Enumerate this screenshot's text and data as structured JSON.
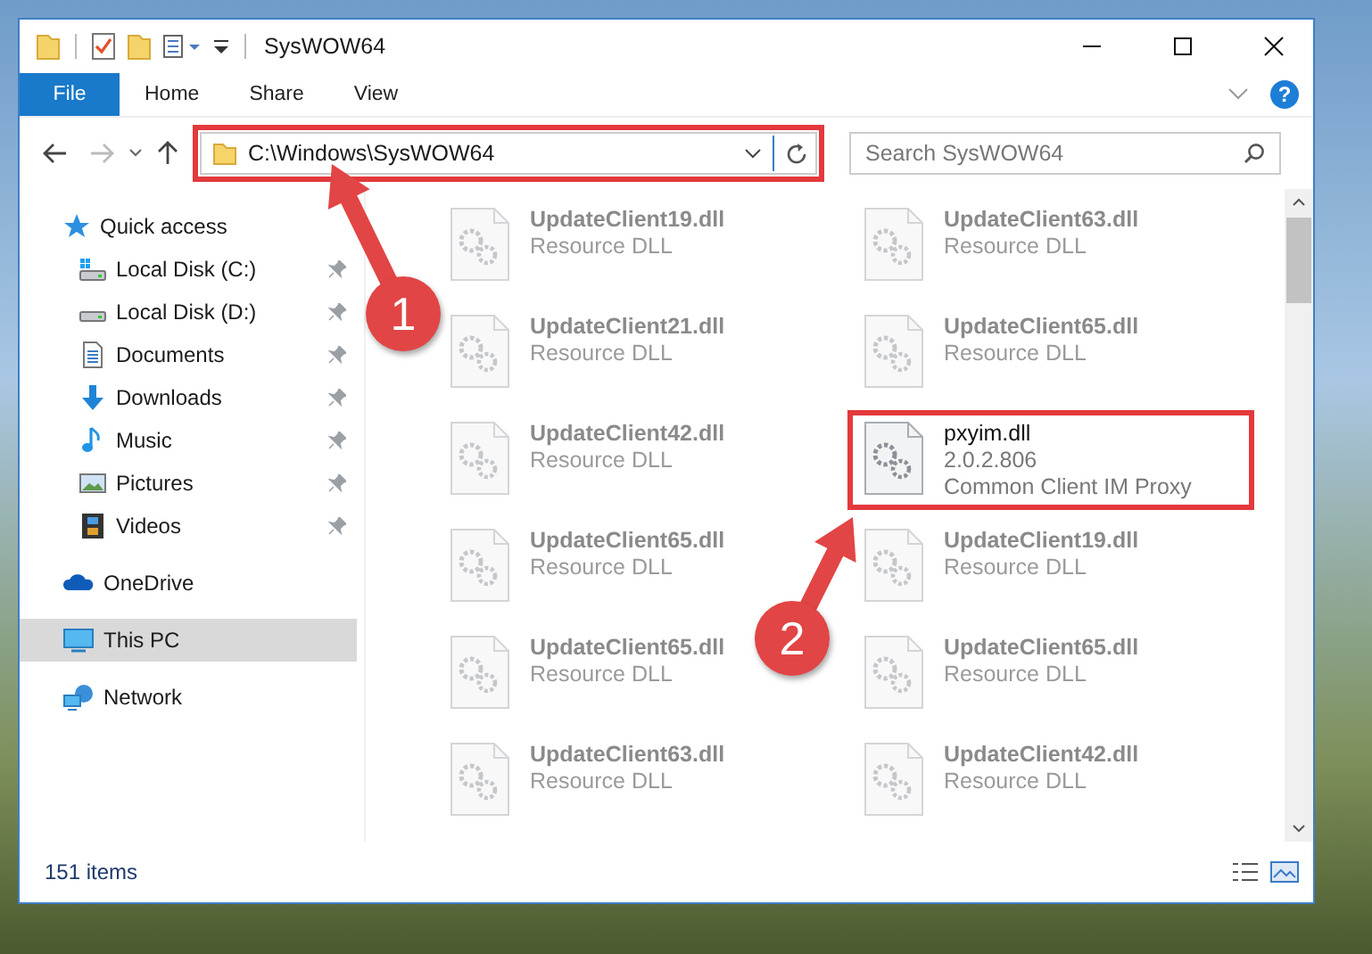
{
  "window": {
    "title": "SysWOW64"
  },
  "ribbon": {
    "tabs": [
      {
        "label": "File",
        "selected": true
      },
      {
        "label": "Home",
        "selected": false
      },
      {
        "label": "Share",
        "selected": false
      },
      {
        "label": "View",
        "selected": false
      }
    ]
  },
  "help_button": {
    "label": "?"
  },
  "address_bar": {
    "path": "C:\\Windows\\SysWOW64",
    "highlighted": true
  },
  "search": {
    "placeholder": "Search SysWOW64"
  },
  "sidebar": {
    "items": [
      {
        "label": "Quick access",
        "kind": "star",
        "selected": false,
        "children": [
          {
            "label": "Local Disk (C:)",
            "kind": "system-drive",
            "selected": false,
            "pinned": true
          },
          {
            "label": "Local Disk (D:)",
            "kind": "drive",
            "selected": false,
            "pinned": true
          },
          {
            "label": "Documents",
            "kind": "documents",
            "selected": false,
            "pinned": true
          },
          {
            "label": "Downloads",
            "kind": "downloads",
            "selected": false,
            "pinned": true
          },
          {
            "label": "Music",
            "kind": "music",
            "selected": false,
            "pinned": true
          },
          {
            "label": "Pictures",
            "kind": "pictures",
            "selected": false,
            "pinned": true
          },
          {
            "label": "Videos",
            "kind": "videos",
            "selected": false,
            "pinned": true
          }
        ]
      },
      {
        "label": "OneDrive",
        "kind": "cloud",
        "selected": false
      },
      {
        "label": "This PC",
        "kind": "pc",
        "selected": true
      },
      {
        "label": "Network",
        "kind": "network",
        "selected": false
      }
    ]
  },
  "files": [
    {
      "name": "UpdateClient19.dll",
      "details": [
        "Resource DLL"
      ],
      "blurred": true,
      "highlighted": false
    },
    {
      "name": "UpdateClient63.dll",
      "details": [
        "Resource DLL"
      ],
      "blurred": true,
      "highlighted": false
    },
    {
      "name": "UpdateClient21.dll",
      "details": [
        "Resource DLL"
      ],
      "blurred": true,
      "highlighted": false
    },
    {
      "name": "UpdateClient65.dll",
      "details": [
        "Resource DLL"
      ],
      "blurred": true,
      "highlighted": false
    },
    {
      "name": "UpdateClient42.dll",
      "details": [
        "Resource DLL"
      ],
      "blurred": true,
      "highlighted": false
    },
    {
      "name": "pxyim.dll",
      "details": [
        "2.0.2.806",
        "Common Client IM Proxy"
      ],
      "blurred": false,
      "highlighted": true
    },
    {
      "name": "UpdateClient65.dll",
      "details": [
        "Resource DLL"
      ],
      "blurred": true,
      "highlighted": false
    },
    {
      "name": "UpdateClient19.dll",
      "details": [
        "Resource DLL"
      ],
      "blurred": true,
      "highlighted": false
    },
    {
      "name": "UpdateClient65.dll",
      "details": [
        "Resource DLL"
      ],
      "blurred": true,
      "highlighted": false
    },
    {
      "name": "UpdateClient65.dll",
      "details": [
        "Resource DLL"
      ],
      "blurred": true,
      "highlighted": false
    },
    {
      "name": "UpdateClient63.dll",
      "details": [
        "Resource DLL"
      ],
      "blurred": true,
      "highlighted": false
    },
    {
      "name": "UpdateClient42.dll",
      "details": [
        "Resource DLL"
      ],
      "blurred": true,
      "highlighted": false
    }
  ],
  "status_bar": {
    "item_count": "151 items"
  },
  "callouts": [
    {
      "number": "1"
    },
    {
      "number": "2"
    }
  ]
}
